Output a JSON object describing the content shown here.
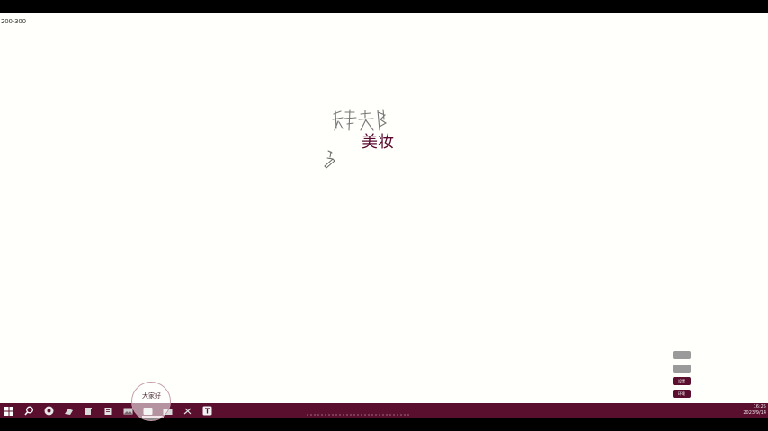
{
  "document": {
    "corner_label": "200-300",
    "typed_word": "美妆"
  },
  "side_buttons": {
    "b1": "",
    "b2": "",
    "b3": "设置",
    "b4": "环境"
  },
  "bubble": {
    "label": "大家好"
  },
  "taskbar": {
    "icons": [
      "windows-start-icon",
      "search-icon",
      "chrome-icon",
      "app-icon",
      "bin-icon",
      "doc-icon",
      "photo-icon",
      "active-app-icon",
      "folder-icon",
      "pin-icon",
      "text-app-icon"
    ],
    "clock_time": "16:25",
    "clock_date": "2023/9/14"
  },
  "colors": {
    "taskbar": "#5a0f2e",
    "ink": "#5a0a30",
    "canvas": "#fffffb"
  }
}
